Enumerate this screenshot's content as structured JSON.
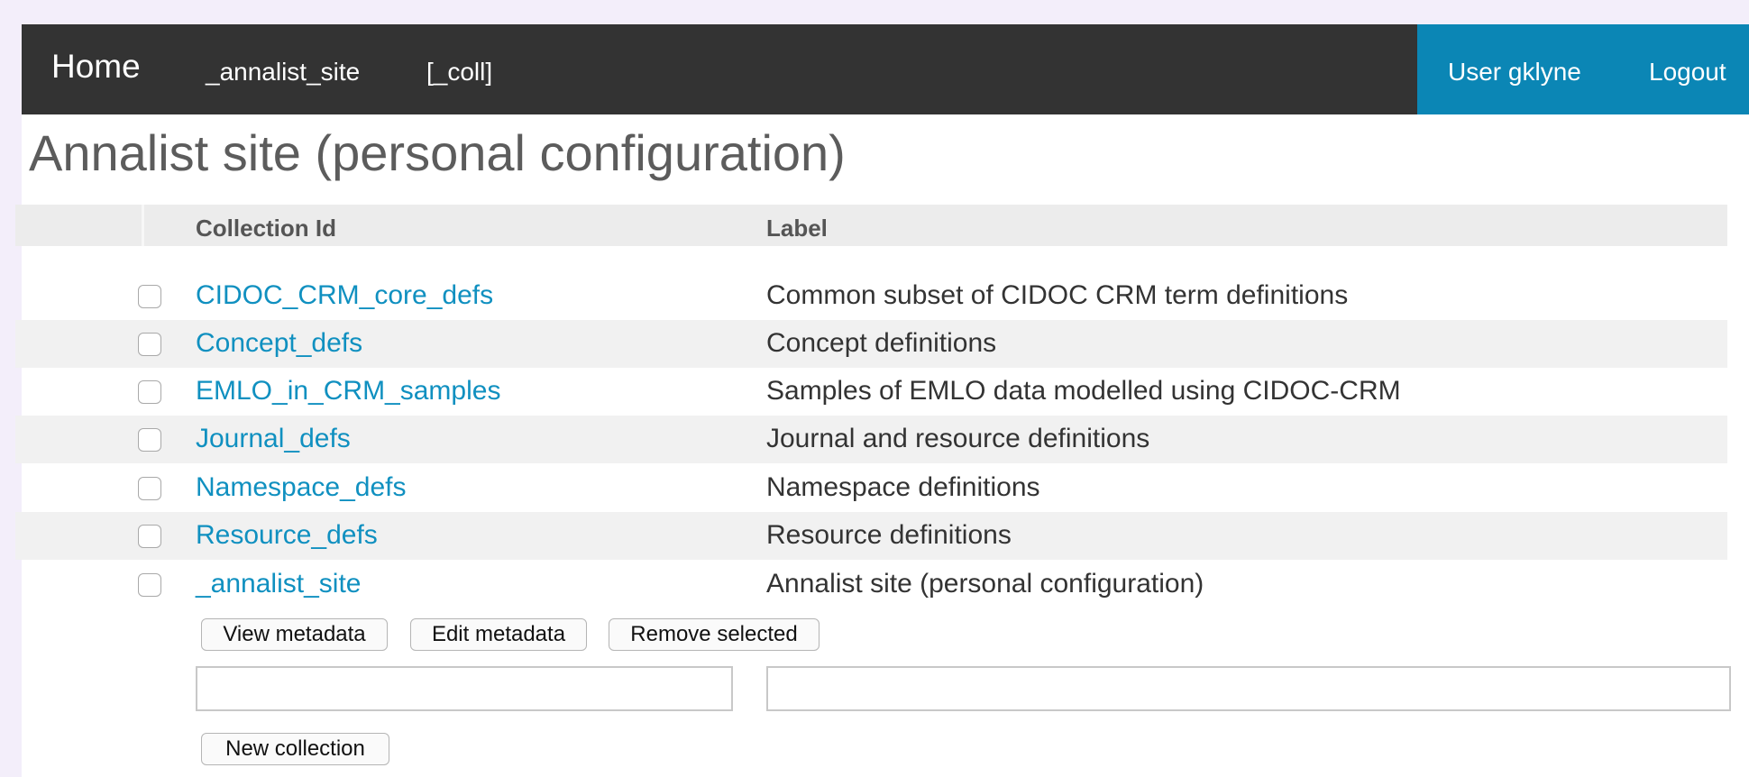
{
  "nav": {
    "home": "Home",
    "site": "_annalist_site",
    "coll": "[_coll]",
    "user": "User gklyne",
    "logout": "Logout"
  },
  "page": {
    "title": "Annalist site (personal configuration)"
  },
  "table": {
    "headers": [
      "Collection Id",
      "Label"
    ],
    "rows": [
      {
        "id": "CIDOC_CRM_core_defs",
        "label": "Common subset of CIDOC CRM term definitions"
      },
      {
        "id": "Concept_defs",
        "label": "Concept definitions"
      },
      {
        "id": "EMLO_in_CRM_samples",
        "label": "Samples of EMLO data modelled using CIDOC-CRM"
      },
      {
        "id": "Journal_defs",
        "label": "Journal and resource definitions"
      },
      {
        "id": "Namespace_defs",
        "label": "Namespace definitions"
      },
      {
        "id": "Resource_defs",
        "label": "Resource definitions"
      },
      {
        "id": "_annalist_site",
        "label": "Annalist site (personal configuration)"
      }
    ]
  },
  "actions": {
    "view_metadata": "View metadata",
    "edit_metadata": "Edit metadata",
    "remove_selected": "Remove selected",
    "new_collection": "New collection"
  },
  "new_form": {
    "id_value": "",
    "label_value": ""
  }
}
